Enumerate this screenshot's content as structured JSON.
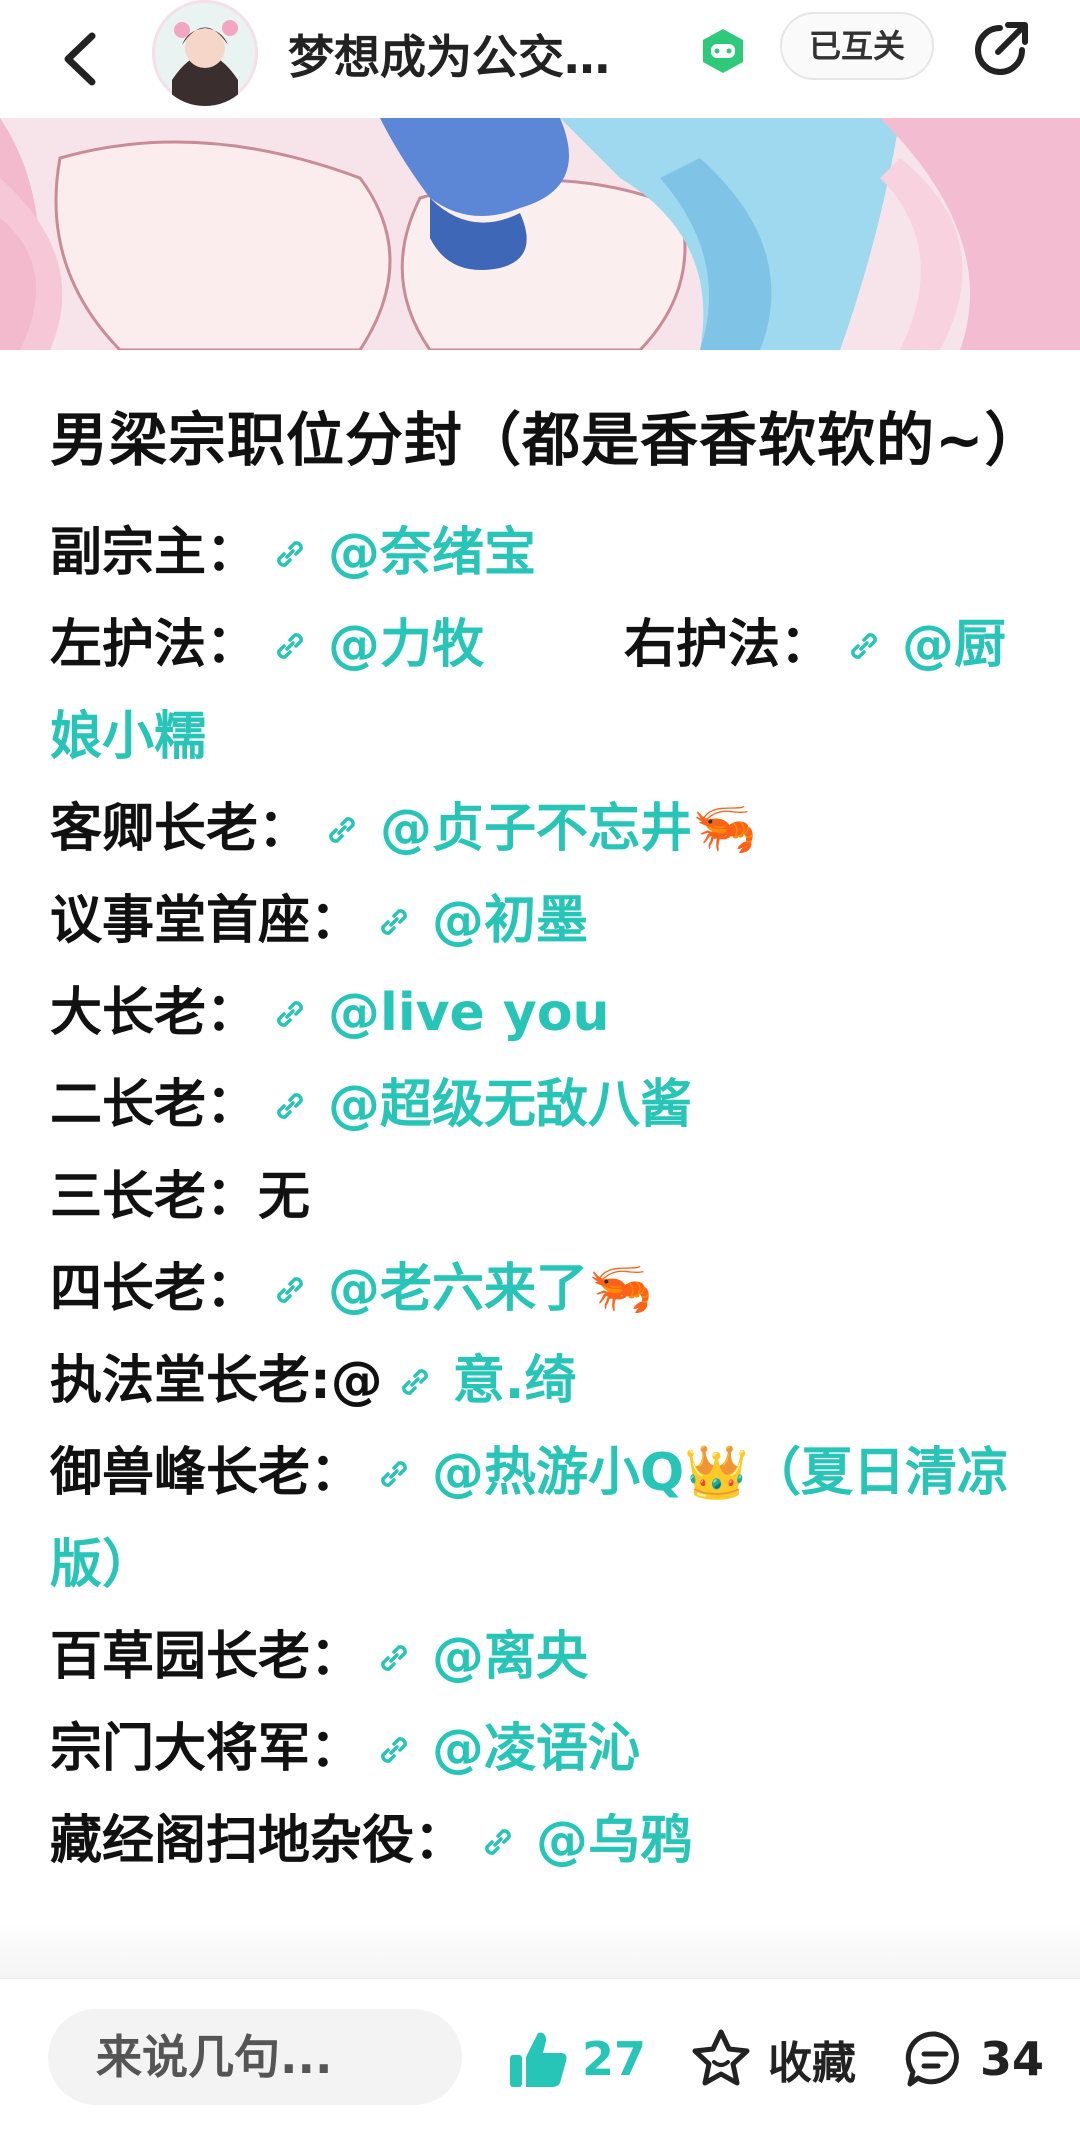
{
  "header": {
    "title": "梦想成为公交…",
    "mutual_label": "已互关"
  },
  "post": {
    "title": "男梁宗职位分封（都是香香软软的~）",
    "lines": [
      {
        "label": "副宗主：",
        "mention": "@奈绪宝"
      },
      {
        "label": "左护法：",
        "mention": "@力牧",
        "label2": "右护法：",
        "mention2": "@厨娘小糯"
      },
      {
        "label": "客卿长老：",
        "mention": "@贞子不忘井🦐"
      },
      {
        "label": "议事堂首座：",
        "mention": "@初墨"
      },
      {
        "label": "大长老：",
        "mention": "@live you"
      },
      {
        "label": "二长老：",
        "mention": "@超级无敌八酱"
      },
      {
        "label": "三长老：无"
      },
      {
        "label": "四长老：",
        "mention": "@老六来了🦐"
      },
      {
        "label": "执法堂长老:@",
        "mention": "意.绮"
      },
      {
        "label": "御兽峰长老：",
        "mention": "@热游小Q👑（夏日清凉版）"
      },
      {
        "label": "百草园长老：",
        "mention": "@离央"
      },
      {
        "label": "宗门大将军：",
        "mention": "@凌语沁"
      },
      {
        "label": "藏经阁扫地杂役：",
        "mention": "@乌鸦"
      }
    ]
  },
  "bottom_bar": {
    "comment_placeholder": "来说几句...",
    "like_count": "27",
    "favorite_label": "收藏",
    "comment_count": "34"
  },
  "colors": {
    "accent": "#27c4b8",
    "text": "#111111"
  }
}
